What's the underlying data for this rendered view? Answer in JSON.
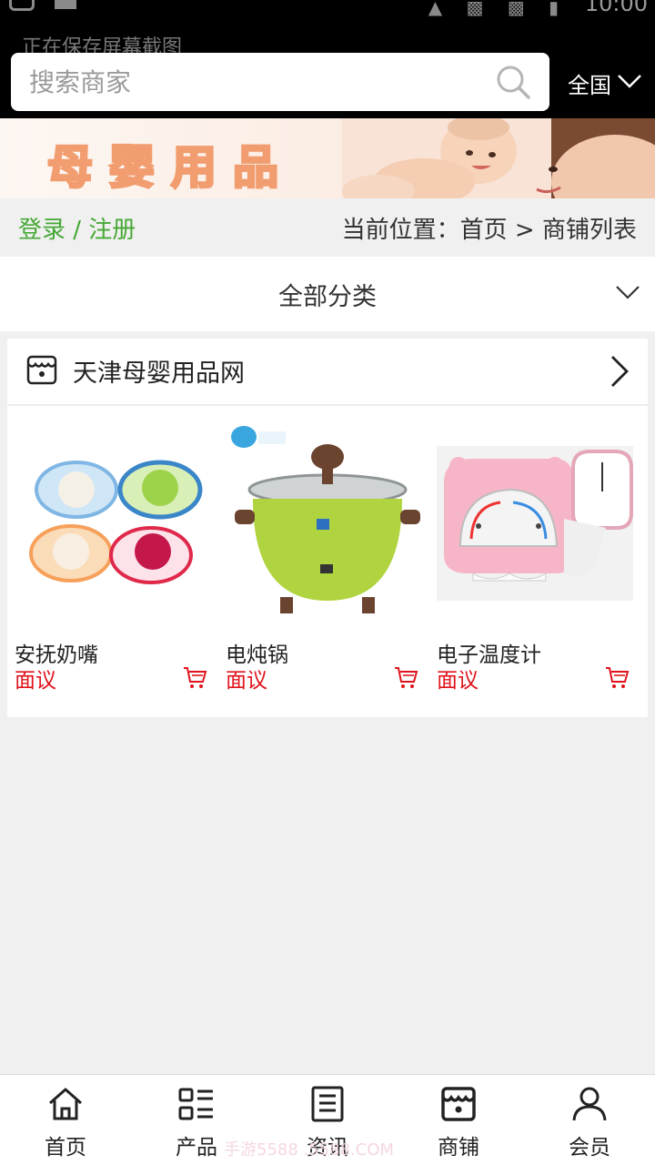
{
  "status_bar": {
    "time": "10:00",
    "notice": "正在保存屏幕截图"
  },
  "header": {
    "search_placeholder": "搜索商家",
    "region": "全国"
  },
  "banner": {
    "title": "母婴用品"
  },
  "breadcrumb": {
    "login": "登录 / 注册",
    "location": "当前位置：首页 > 商铺列表"
  },
  "category": {
    "label": "全部分类"
  },
  "shop": {
    "name": "天津母婴用品网",
    "products": [
      {
        "name": "安抚奶嘴",
        "price": "面议"
      },
      {
        "name": "电炖锅",
        "price": "面议"
      },
      {
        "name": "电子温度计",
        "price": "面议"
      }
    ]
  },
  "bottom_nav": {
    "items": [
      {
        "label": "首页",
        "icon": "home-icon"
      },
      {
        "label": "产品",
        "icon": "list-icon"
      },
      {
        "label": "资讯",
        "icon": "news-icon"
      },
      {
        "label": "商铺",
        "icon": "store-icon"
      },
      {
        "label": "会员",
        "icon": "user-icon"
      }
    ],
    "watermark": "手游5588 .5588.COM"
  },
  "colors": {
    "accent_green": "#45a834",
    "price_red": "#e0131c",
    "header_bg": "#000000",
    "page_bg": "#f0f0f0"
  }
}
